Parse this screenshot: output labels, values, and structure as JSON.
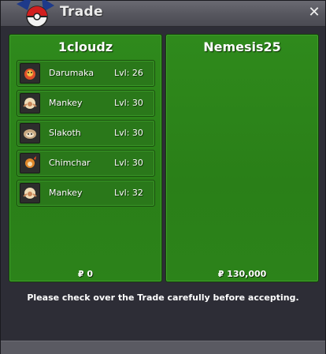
{
  "window": {
    "title": "Trade",
    "close_icon": "close-icon",
    "logo_icon": "pokeball-logo-icon"
  },
  "left_panel": {
    "trainer": "1cloudz",
    "money": "₽ 0",
    "pokemon": [
      {
        "name": "Darumaka",
        "level": "Lvl: 26",
        "icon": "darumaka-sprite-icon"
      },
      {
        "name": "Mankey",
        "level": "Lvl: 30",
        "icon": "mankey-sprite-icon"
      },
      {
        "name": "Slakoth",
        "level": "Lvl: 30",
        "icon": "slakoth-sprite-icon"
      },
      {
        "name": "Chimchar",
        "level": "Lvl: 30",
        "icon": "chimchar-sprite-icon"
      },
      {
        "name": "Mankey",
        "level": "Lvl: 32",
        "icon": "mankey-sprite-icon"
      }
    ]
  },
  "right_panel": {
    "trainer": "Nemesis25",
    "money": "₽ 130,000",
    "pokemon": []
  },
  "notice": "Please check over the Trade carefully before accepting.",
  "colors": {
    "panel_green": "#2c831a",
    "titlebar": "#5a5a62",
    "window_bg": "#2d2d36"
  }
}
